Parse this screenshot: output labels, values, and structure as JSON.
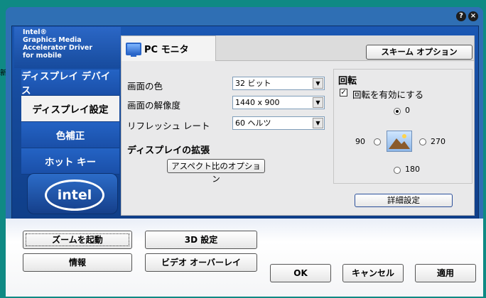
{
  "desktop": {
    "fragment": "新"
  },
  "window": {
    "titlebar_buttons": [
      "?",
      "×"
    ]
  },
  "sidebar": {
    "brand_lines": [
      "Intel®",
      "Graphics Media",
      "Accelerator Driver",
      "for mobile"
    ],
    "items": [
      {
        "label": "ディスプレイ デバイス",
        "active": false
      },
      {
        "label": "ディスプレイ設定",
        "active": true
      },
      {
        "label": "色補正",
        "active": false
      },
      {
        "label": "ホット キー",
        "active": false
      }
    ],
    "logo_text": "intel"
  },
  "content": {
    "tab_label": "PC モニタ",
    "scheme_button": "スキーム オプション",
    "settings": [
      {
        "label": "画面の色",
        "value": "32 ビット"
      },
      {
        "label": "画面の解像度",
        "value": "1440 x 900"
      },
      {
        "label": "リフレッシュ レート",
        "value": "60 ヘルツ"
      }
    ],
    "extension_heading": "ディスプレイの拡張",
    "aspect_button": "アスペクト比のオプション",
    "rotation": {
      "heading": "回転",
      "enable_label": "回転を有効にする",
      "enabled": true,
      "options": [
        "0",
        "90",
        "270",
        "180"
      ],
      "selected": "0"
    },
    "detail_button": "詳細設定"
  },
  "lower": {
    "zoom_button": "ズームを起動",
    "settings3d_button": "3D 設定",
    "info_button": "情報",
    "video_overlay_button": "ビデオ オーバーレイ",
    "ok_button": "OK",
    "cancel_button": "キャンセル",
    "apply_button": "適用"
  },
  "colors": {
    "desktop_bg": "#0f8a84",
    "frame_blue": "#2f6fb4",
    "panel_gray": "#e9e9ea"
  }
}
